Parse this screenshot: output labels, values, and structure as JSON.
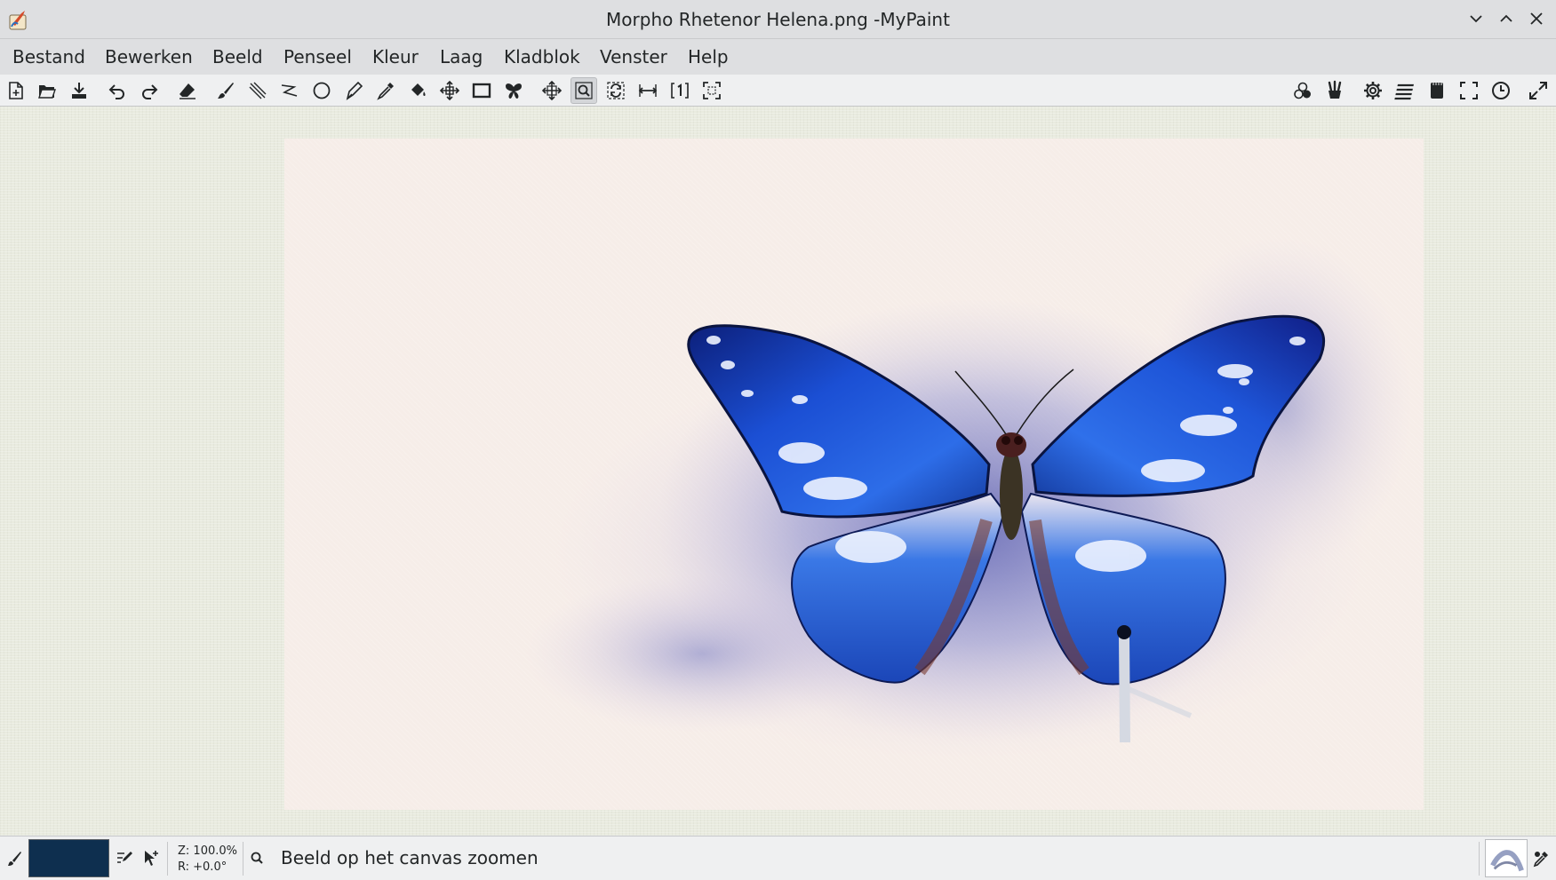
{
  "window": {
    "title": "Morpho Rhetenor Helena.png -MyPaint"
  },
  "menubar": {
    "items": [
      "Bestand",
      "Bewerken",
      "Beeld",
      "Penseel",
      "Kleur",
      "Laag",
      "Kladblok",
      "Venster",
      "Help"
    ]
  },
  "toolbar": {
    "left_icons": [
      "new-document-icon",
      "open-file-icon",
      "save-file-icon",
      "undo-icon",
      "redo-icon",
      "eraser-icon",
      "freehand-brush-icon",
      "ink-lines-icon",
      "connected-lines-icon",
      "ellipse-icon",
      "inking-pen-icon",
      "color-picker-icon",
      "fill-bucket-icon",
      "move-layer-icon",
      "frame-icon",
      "symmetry-butterfly-icon",
      "pan-view-icon",
      "zoom-view-icon",
      "rotate-view-icon",
      "mirror-view-icon",
      "reset-zoom-icon",
      "fit-view-icon"
    ],
    "active_tool": "zoom-view-icon",
    "right_icons": [
      "color-wheel-icon",
      "brush-palette-icon",
      "preferences-gear-icon",
      "layers-icon",
      "scratchpad-icon",
      "fullscreen-icon",
      "history-clock-icon",
      "expand-icon"
    ]
  },
  "canvas": {
    "background_color": "#e9ebdf",
    "paper_color": "#f6ede8",
    "artwork": "butterfly painting"
  },
  "statusbar": {
    "current_color": "#0e2f4f",
    "zoom_text": "Z: 100.0%",
    "rotation_text": "R: +0.0°",
    "message": "Beeld op het canvas zoomen"
  }
}
